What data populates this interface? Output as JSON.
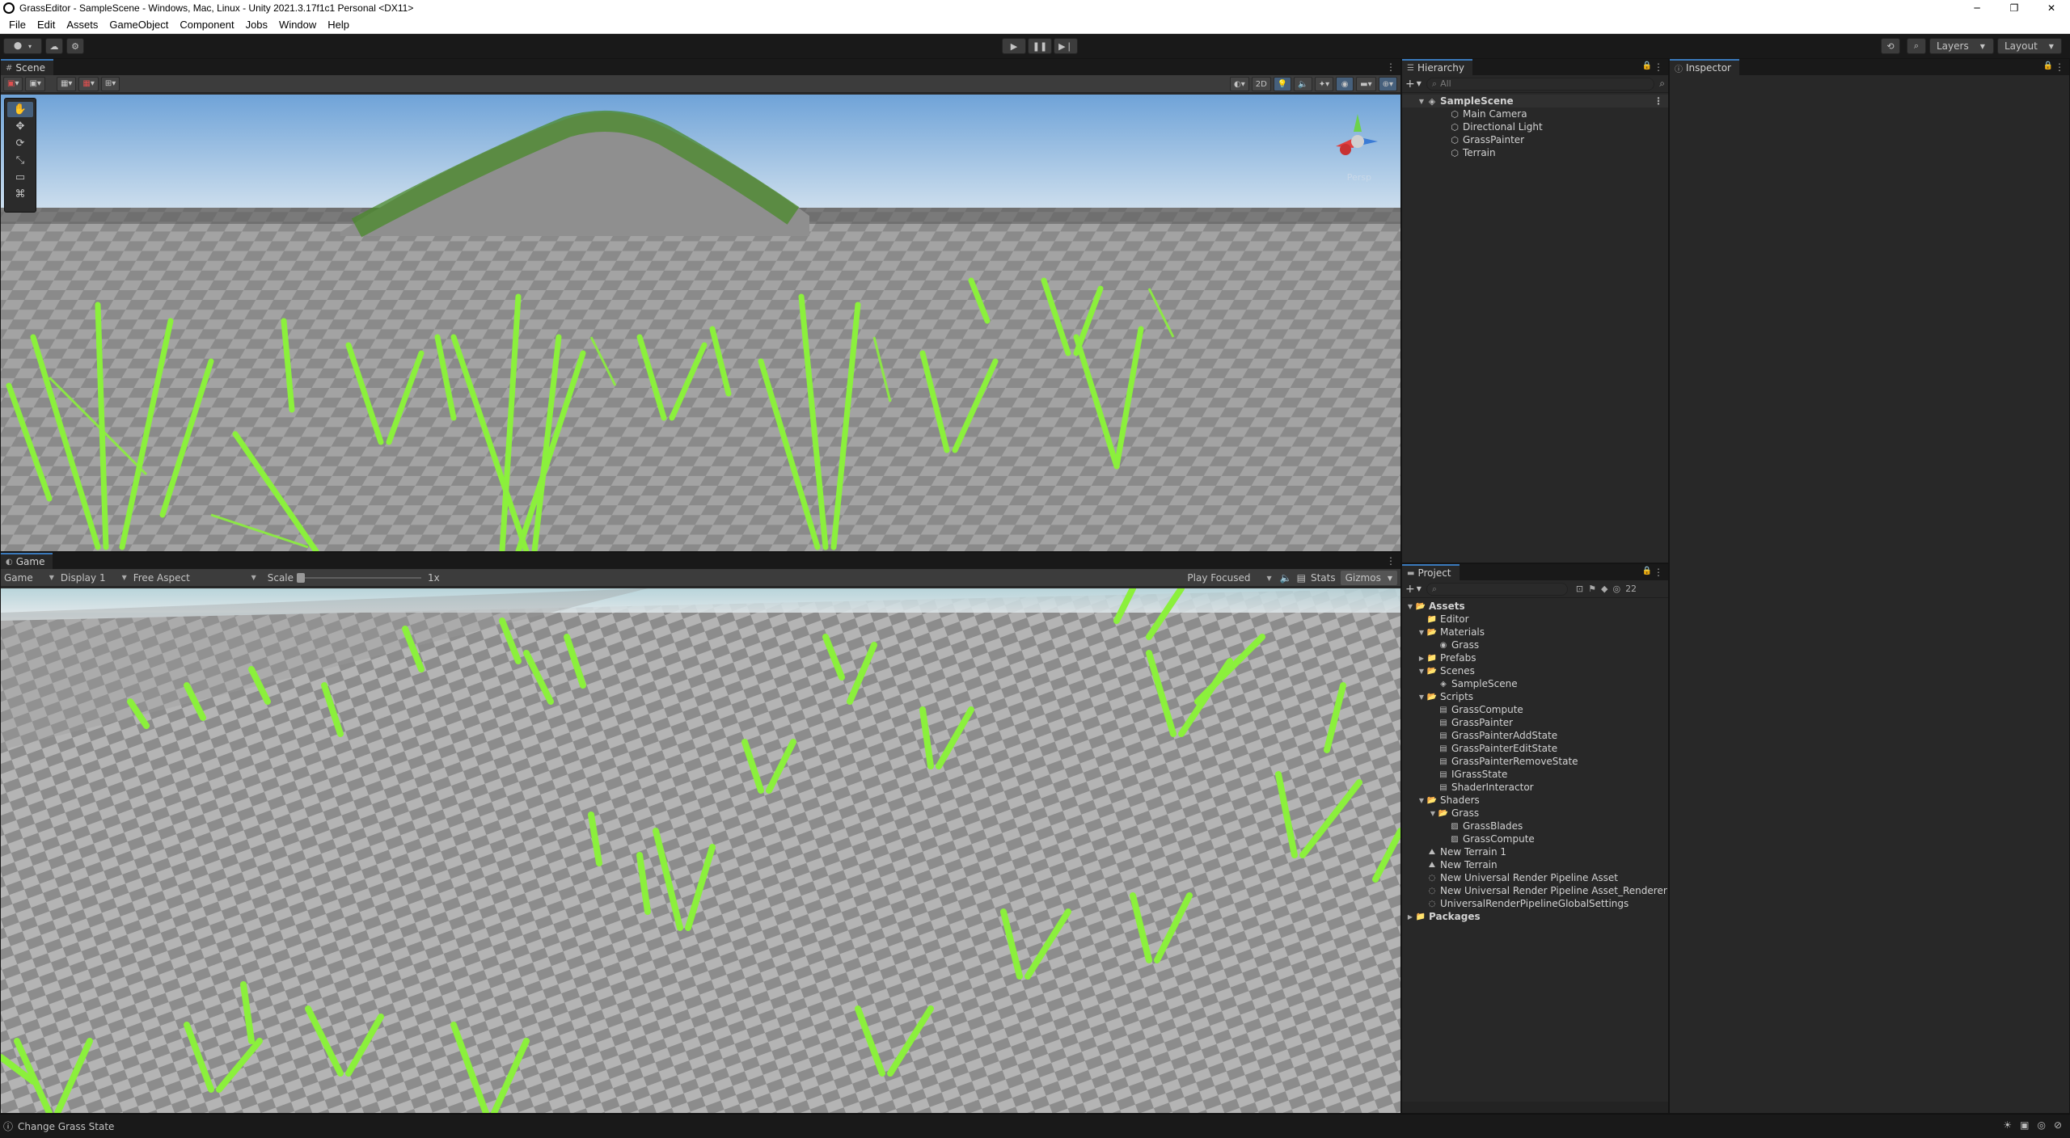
{
  "window": {
    "title": "GrassEditor - SampleScene - Windows, Mac, Linux - Unity 2021.3.17f1c1 Personal <DX11>",
    "minimize": "─",
    "restore": "❐",
    "close": "✕"
  },
  "menu": [
    "File",
    "Edit",
    "Assets",
    "GameObject",
    "Component",
    "Jobs",
    "Window",
    "Help"
  ],
  "toolbar": {
    "account_label": "⬤",
    "play": "▶",
    "pause": "❚❚",
    "step": "▶❘",
    "layers_label": "Layers",
    "layout_label": "Layout"
  },
  "scene": {
    "tab_label": "Scene",
    "two_d_label": "2D",
    "persp_label": "Persp",
    "tools": [
      "✋",
      "✥",
      "⟳",
      "⤡",
      "▭",
      "⌘"
    ]
  },
  "game": {
    "tab_label": "Game",
    "mode_dropdown": "Game",
    "display_dropdown": "Display 1",
    "aspect_dropdown": "Free Aspect",
    "scale_label": "Scale",
    "scale_value": "1x",
    "play_focused": "Play Focused",
    "stats_label": "Stats",
    "gizmos_label": "Gizmos"
  },
  "hierarchy": {
    "tab_label": "Hierarchy",
    "search_placeholder": "All",
    "scene_name": "SampleScene",
    "items": [
      "Main Camera",
      "Directional Light",
      "GrassPainter",
      "Terrain"
    ]
  },
  "inspector": {
    "tab_label": "Inspector"
  },
  "project": {
    "tab_label": "Project",
    "hidden_count": "22",
    "tree": [
      {
        "label": "Assets",
        "depth": 0,
        "fold": "▼",
        "icon": "📂",
        "bold": true
      },
      {
        "label": "Editor",
        "depth": 1,
        "fold": "",
        "icon": "📁"
      },
      {
        "label": "Materials",
        "depth": 1,
        "fold": "▼",
        "icon": "📂"
      },
      {
        "label": "Grass",
        "depth": 2,
        "fold": "",
        "icon": "◉"
      },
      {
        "label": "Prefabs",
        "depth": 1,
        "fold": "▶",
        "icon": "📁"
      },
      {
        "label": "Scenes",
        "depth": 1,
        "fold": "▼",
        "icon": "📂"
      },
      {
        "label": "SampleScene",
        "depth": 2,
        "fold": "",
        "icon": "◈"
      },
      {
        "label": "Scripts",
        "depth": 1,
        "fold": "▼",
        "icon": "📂"
      },
      {
        "label": "GrassCompute",
        "depth": 2,
        "fold": "",
        "icon": "▤"
      },
      {
        "label": "GrassPainter",
        "depth": 2,
        "fold": "",
        "icon": "▤"
      },
      {
        "label": "GrassPainterAddState",
        "depth": 2,
        "fold": "",
        "icon": "▤"
      },
      {
        "label": "GrassPainterEditState",
        "depth": 2,
        "fold": "",
        "icon": "▤"
      },
      {
        "label": "GrassPainterRemoveState",
        "depth": 2,
        "fold": "",
        "icon": "▤"
      },
      {
        "label": "IGrassState",
        "depth": 2,
        "fold": "",
        "icon": "▤"
      },
      {
        "label": "ShaderInteractor",
        "depth": 2,
        "fold": "",
        "icon": "▤"
      },
      {
        "label": "Shaders",
        "depth": 1,
        "fold": "▼",
        "icon": "📂"
      },
      {
        "label": "Grass",
        "depth": 2,
        "fold": "▼",
        "icon": "📂"
      },
      {
        "label": "GrassBlades",
        "depth": 3,
        "fold": "",
        "icon": "▨"
      },
      {
        "label": "GrassCompute",
        "depth": 3,
        "fold": "",
        "icon": "▨"
      },
      {
        "label": "New Terrain 1",
        "depth": 1,
        "fold": "",
        "icon": "⛰"
      },
      {
        "label": "New Terrain",
        "depth": 1,
        "fold": "",
        "icon": "⛰"
      },
      {
        "label": "New Universal Render Pipeline Asset",
        "depth": 1,
        "fold": "",
        "icon": "◌"
      },
      {
        "label": "New Universal Render Pipeline Asset_Renderer",
        "depth": 1,
        "fold": "",
        "icon": "◌"
      },
      {
        "label": "UniversalRenderPipelineGlobalSettings",
        "depth": 1,
        "fold": "",
        "icon": "◌"
      },
      {
        "label": "Packages",
        "depth": 0,
        "fold": "▶",
        "icon": "📁",
        "bold": true
      }
    ]
  },
  "status": {
    "message": "Change Grass State"
  },
  "colors": {
    "grass": "#8bf03c",
    "accent": "#3a79bb",
    "panel": "#282828"
  }
}
